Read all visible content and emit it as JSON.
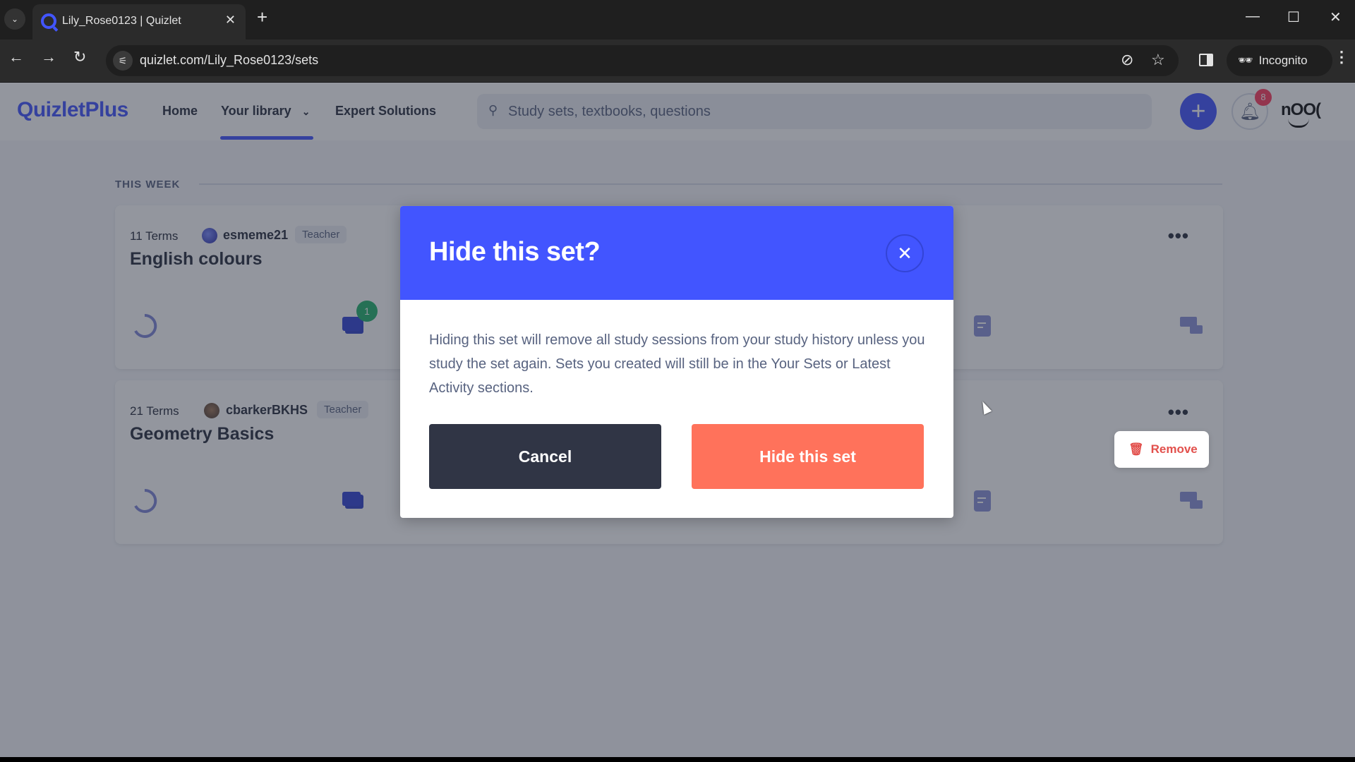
{
  "browser": {
    "tab_title": "Lily_Rose0123 | Quizlet",
    "url": "quizlet.com/Lily_Rose0123/sets",
    "incognito_label": "Incognito",
    "new_tab_symbol": "+",
    "close_symbol": "✕"
  },
  "header": {
    "logo": "QuizletPlus",
    "nav": [
      {
        "label": "Home"
      },
      {
        "label": "Your library",
        "active": true
      },
      {
        "label": "Expert Solutions"
      }
    ],
    "search_placeholder": "Study sets, textbooks, questions",
    "notification_count": "8",
    "avatar_text": "nOO("
  },
  "section": {
    "label": "THIS WEEK"
  },
  "sets": [
    {
      "terms": "11 Terms",
      "username": "esmeme21",
      "role": "Teacher",
      "title": "English colours",
      "flashcards_badge": "1"
    },
    {
      "terms": "21 Terms",
      "username": "cbarkerBKHS",
      "role": "Teacher",
      "title": "Geometry Basics"
    }
  ],
  "context_menu": {
    "remove_label": "Remove"
  },
  "modal": {
    "title": "Hide this set?",
    "body": "Hiding this set will remove all study sessions from your study history unless you study the set again. Sets you created will still be in the Your Sets or Latest Activity sections.",
    "cancel_label": "Cancel",
    "confirm_label": "Hide this set"
  },
  "colors": {
    "brand": "#4255ff",
    "danger": "#ff725b",
    "dark_button": "#303545"
  }
}
